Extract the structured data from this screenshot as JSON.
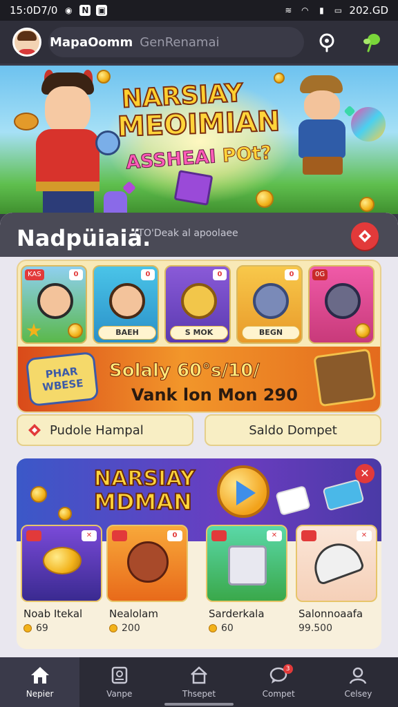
{
  "status_bar": {
    "time": "15:0D7/0",
    "right_text": "202.GD"
  },
  "header": {
    "username": "MapaOomm",
    "subtitle": "GenRenamai"
  },
  "hero": {
    "title_line1": "NARSIAY",
    "title_line2": "MEOIMIAN",
    "title_line3_a": "ASSHEAI",
    "title_line3_b": "POt?"
  },
  "section": {
    "title": "Nadpüiaiä.",
    "subtitle": "(TO'Deak al apoolaee"
  },
  "games": [
    {
      "tag": "KAS",
      "badge": "0",
      "label": ""
    },
    {
      "tag": "",
      "badge": "0",
      "label": "BAEH"
    },
    {
      "tag": "",
      "badge": "0",
      "label": "S MOK"
    },
    {
      "tag": "",
      "badge": "0",
      "label": "BEGN"
    },
    {
      "tag": "",
      "badge": "0G",
      "label": ""
    }
  ],
  "promo": {
    "badge_line1": "PHAR",
    "badge_line2": "WBESE",
    "line1": "Solaly 60°s/10/",
    "line2": "Vank lon Mon 290"
  },
  "actions": {
    "left_label": "Pudole Hampal",
    "right_label": "Saldo Dompet"
  },
  "promo2": {
    "title_line1": "NARSIAY",
    "title_line2": "MDMAN"
  },
  "tiles": [
    {
      "name": "Noab Itekal",
      "price": "69"
    },
    {
      "name": "Nealolam",
      "price": "200"
    },
    {
      "name": "Sarderkala",
      "price": "60"
    },
    {
      "name": "Salonnoaafa",
      "price": "99.500"
    }
  ],
  "nav": [
    {
      "label": "Nepier",
      "icon": "home-icon"
    },
    {
      "label": "Vanpe",
      "icon": "document-icon"
    },
    {
      "label": "Thsepet",
      "icon": "house-outline-icon"
    },
    {
      "label": "Compet",
      "icon": "chat-icon",
      "badge": "3"
    },
    {
      "label": "Celsey",
      "icon": "profile-icon"
    }
  ],
  "colors": {
    "accent_red": "#e23a3a",
    "gold": "#f2b21a",
    "nav_bg": "#2b2b36"
  }
}
